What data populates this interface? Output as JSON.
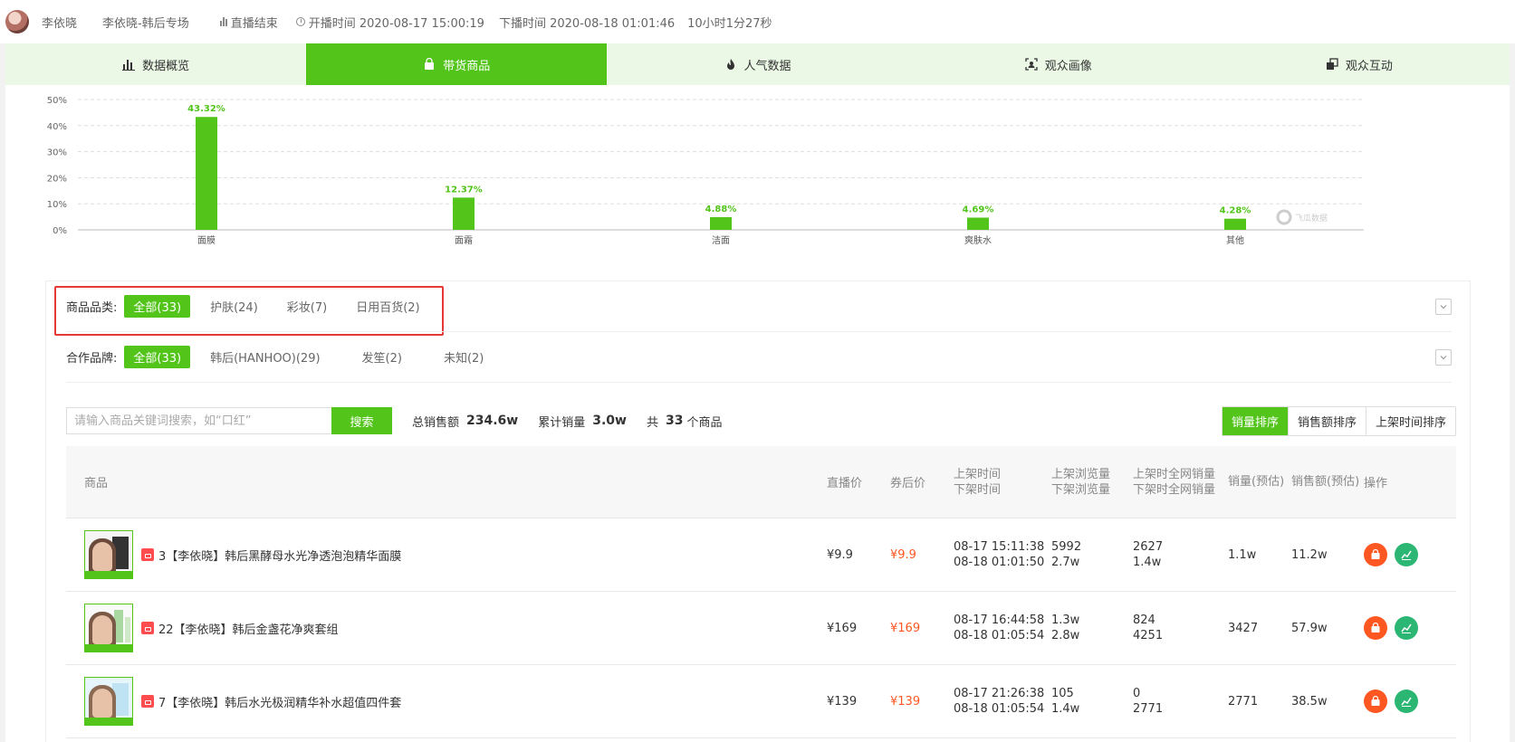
{
  "header": {
    "name": "李依晓",
    "room": "李依晓-韩后专场",
    "status": "直播结束",
    "start": "开播时间 2020-08-17 15:00:19",
    "end": "下播时间 2020-08-18 01:01:46",
    "duration": "10小时1分27秒"
  },
  "tabs": [
    {
      "label": "数据概览",
      "icon": "bar-chart-icon"
    },
    {
      "label": "带货商品",
      "icon": "shopping-bag-icon",
      "active": true
    },
    {
      "label": "人气数据",
      "icon": "flame-icon"
    },
    {
      "label": "观众画像",
      "icon": "portrait-icon"
    },
    {
      "label": "观众互动",
      "icon": "interaction-icon"
    }
  ],
  "chart_data": {
    "type": "bar",
    "categories": [
      "面膜",
      "面霜",
      "洁面",
      "爽肤水",
      "其他"
    ],
    "values": [
      43.32,
      12.37,
      4.88,
      4.69,
      4.28
    ],
    "data_labels": [
      "43.32%",
      "12.37%",
      "4.88%",
      "4.69%",
      "4.28%"
    ],
    "yticks": [
      "0%",
      "10%",
      "20%",
      "30%",
      "40%",
      "50%"
    ],
    "ylim": [
      0,
      50
    ],
    "grid": true,
    "bar_color": "#52c41a",
    "watermark": "飞瓜数据"
  },
  "filters": {
    "category_label": "商品品类:",
    "categories": [
      "全部(33)",
      "护肤(24)",
      "彩妆(7)",
      "日用百货(2)"
    ],
    "brand_label": "合作品牌:",
    "brands": [
      "全部(33)",
      "韩后(HANHOO)(29)",
      "发笙(2)",
      "未知(2)"
    ]
  },
  "search": {
    "placeholder": "请输入商品关键词搜索，如“口红”",
    "button": "搜索"
  },
  "stats": {
    "total_label": "总销售额",
    "total_value": "234.6w",
    "cum_label": "累计销量",
    "cum_value": "3.0w",
    "count_prefix": "共",
    "count_value": "33",
    "count_suffix": "个商品"
  },
  "sorts": [
    "销量排序",
    "销售额排序",
    "上架时间排序"
  ],
  "table": {
    "headers": {
      "product": "商品",
      "live_price": "直播价",
      "coupon_price": "券后价",
      "time1": "上架时间",
      "time2": "下架时间",
      "views1": "上架浏览量",
      "views2": "下架浏览量",
      "net1": "上架时全网销量",
      "net2": "下架时全网销量",
      "sales": "销量(预估)",
      "amount": "销售额(预估)",
      "op": "操作"
    },
    "rows": [
      {
        "title": "3【李依晓】韩后黑酵母水光净透泡泡精华面膜",
        "live": "¥9.9",
        "coupon": "¥9.9",
        "on": "08-17 15:11:38",
        "off": "08-18 01:01:50",
        "v_on": "5992",
        "v_off": "2.7w",
        "n_on": "2627",
        "n_off": "1.4w",
        "sales": "1.1w",
        "amount": "11.2w"
      },
      {
        "title": "22【李依晓】韩后金盏花净爽套组",
        "live": "¥169",
        "coupon": "¥169",
        "on": "08-17 16:44:58",
        "off": "08-18 01:05:54",
        "v_on": "1.3w",
        "v_off": "2.8w",
        "n_on": "824",
        "n_off": "4251",
        "sales": "3427",
        "amount": "57.9w"
      },
      {
        "title": "7【李依晓】韩后水光极润精华补水超值四件套",
        "live": "¥139",
        "coupon": "¥139",
        "on": "08-17 21:26:38",
        "off": "08-18 01:05:54",
        "v_on": "105",
        "v_off": "1.4w",
        "n_on": "0",
        "n_off": "2771",
        "sales": "2771",
        "amount": "38.5w"
      }
    ]
  }
}
